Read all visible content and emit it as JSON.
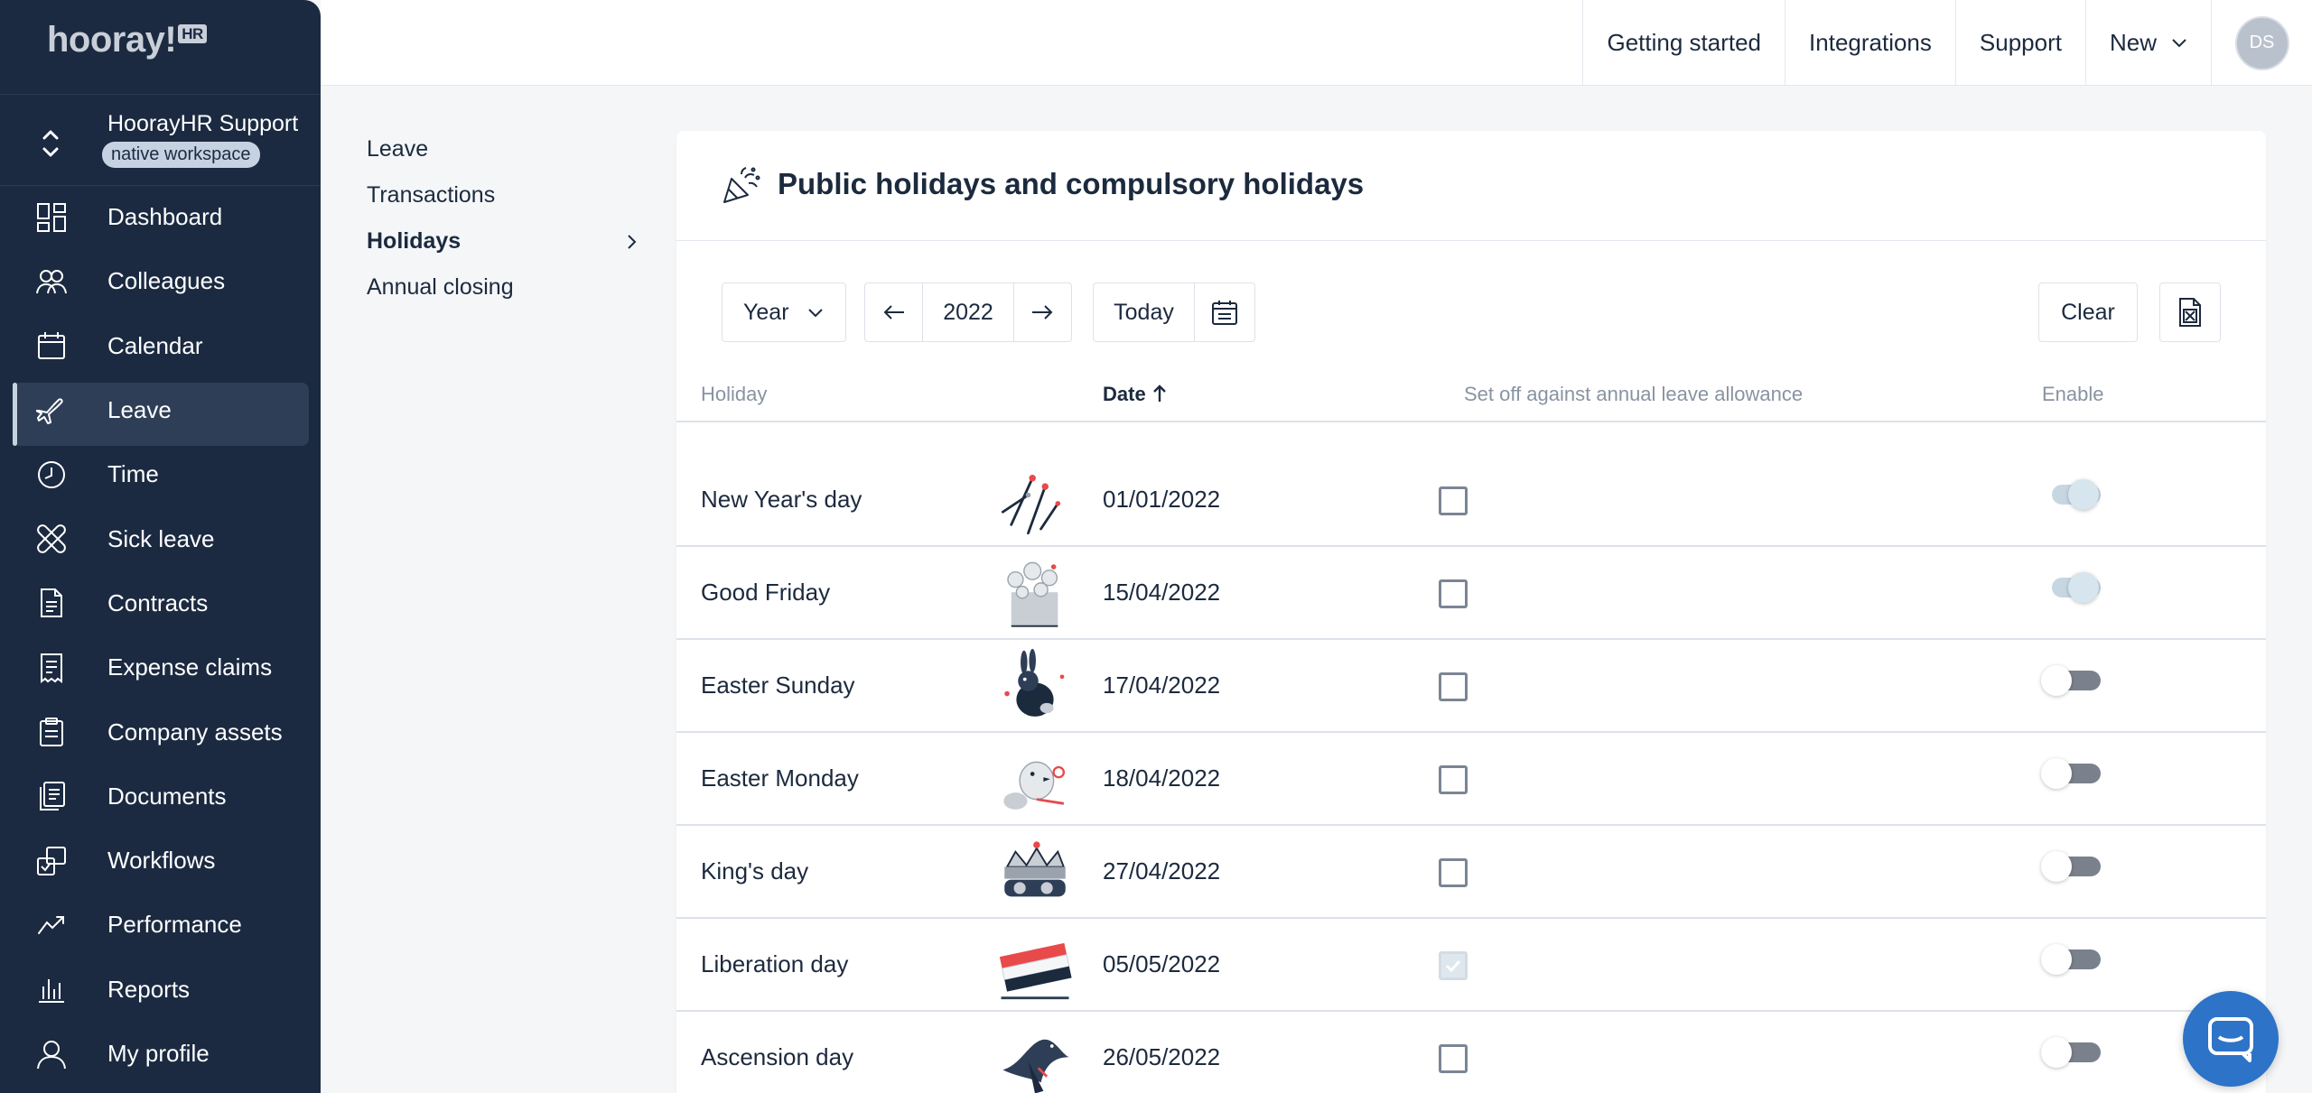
{
  "brand": {
    "logo": "hooray!",
    "logo_sup": "HR"
  },
  "workspace": {
    "name": "HoorayHR Support",
    "badge": "native workspace"
  },
  "sidebar": {
    "items": [
      {
        "label": "Dashboard",
        "icon": "dashboard-icon"
      },
      {
        "label": "Colleagues",
        "icon": "colleagues-icon"
      },
      {
        "label": "Calendar",
        "icon": "calendar-icon"
      },
      {
        "label": "Leave",
        "icon": "plane-icon",
        "active": true
      },
      {
        "label": "Time",
        "icon": "clock-icon"
      },
      {
        "label": "Sick leave",
        "icon": "bandage-icon"
      },
      {
        "label": "Contracts",
        "icon": "document-icon"
      },
      {
        "label": "Expense claims",
        "icon": "receipt-icon"
      },
      {
        "label": "Company assets",
        "icon": "clipboard-icon"
      },
      {
        "label": "Documents",
        "icon": "documents-icon"
      },
      {
        "label": "Workflows",
        "icon": "workflows-icon"
      },
      {
        "label": "Performance",
        "icon": "performance-icon"
      },
      {
        "label": "Reports",
        "icon": "reports-icon"
      },
      {
        "label": "My profile",
        "icon": "user-icon"
      }
    ]
  },
  "topbar": {
    "links": [
      "Getting started",
      "Integrations",
      "Support",
      "New"
    ],
    "avatar_initials": "DS"
  },
  "subnav": {
    "items": [
      "Leave",
      "Transactions",
      "Holidays",
      "Annual closing"
    ],
    "active": "Holidays"
  },
  "page": {
    "title": "Public holidays and compulsory holidays"
  },
  "toolbar": {
    "period": "Year",
    "year": "2022",
    "today_label": "Today",
    "clear_label": "Clear"
  },
  "table": {
    "headers": {
      "holiday": "Holiday",
      "date": "Date",
      "set_off": "Set off against annual leave allowance",
      "enable": "Enable"
    },
    "rows": [
      {
        "name": "New Year's day",
        "date": "01/01/2022",
        "set_off": false,
        "enabled": true,
        "image": "fireworks-image"
      },
      {
        "name": "Good Friday",
        "date": "15/04/2022",
        "set_off": false,
        "enabled": true,
        "image": "flowers-image"
      },
      {
        "name": "Easter Sunday",
        "date": "17/04/2022",
        "set_off": false,
        "enabled": false,
        "image": "rabbit-image"
      },
      {
        "name": "Easter Monday",
        "date": "18/04/2022",
        "set_off": false,
        "enabled": false,
        "image": "chick-image"
      },
      {
        "name": "King's day",
        "date": "27/04/2022",
        "set_off": false,
        "enabled": false,
        "image": "crown-image"
      },
      {
        "name": "Liberation day",
        "date": "05/05/2022",
        "set_off": true,
        "enabled": false,
        "image": "flag-image"
      },
      {
        "name": "Ascension day",
        "date": "26/05/2022",
        "set_off": false,
        "enabled": false,
        "image": "bird-image"
      }
    ]
  },
  "colors": {
    "sidebar_bg": "#1b2a41",
    "accent_light": "#c6d2e1",
    "chat_button": "#2d73c7"
  }
}
